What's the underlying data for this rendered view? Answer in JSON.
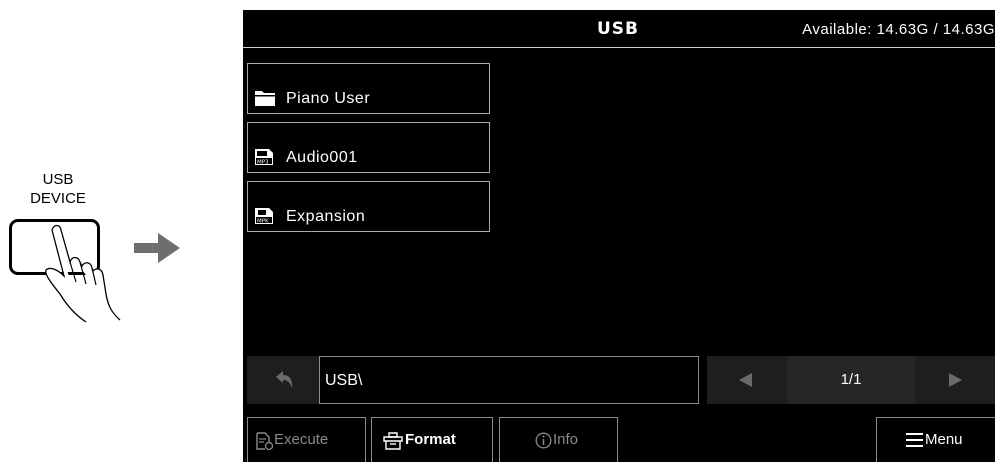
{
  "instruction": {
    "button_label_line1": "USB",
    "button_label_line2": "DEVICE",
    "icons": [
      "finger-press-icon",
      "right-arrow-icon"
    ]
  },
  "header": {
    "title": "USB",
    "available": "Available: 14.63G / 14.63G"
  },
  "files": [
    {
      "name": "Piano User",
      "icon": "folder-icon"
    },
    {
      "name": "Audio001",
      "icon": "mp3-file-icon"
    },
    {
      "name": "Expansion",
      "icon": "mpk-file-icon"
    }
  ],
  "path": {
    "value": "USB\\",
    "back_icon": "back-arrow-icon"
  },
  "pagination": {
    "page": "1/1",
    "prev_icon": "triangle-left-icon",
    "next_icon": "triangle-right-icon"
  },
  "bottom_bar": {
    "execute_label": "Execute",
    "format_label": "Format",
    "info_label": "Info",
    "menu_label": "Menu"
  },
  "colors": {
    "screen_bg": "#000000",
    "disabled_text": "#8a8a8a",
    "panel_gray": "#1e1e1e"
  }
}
